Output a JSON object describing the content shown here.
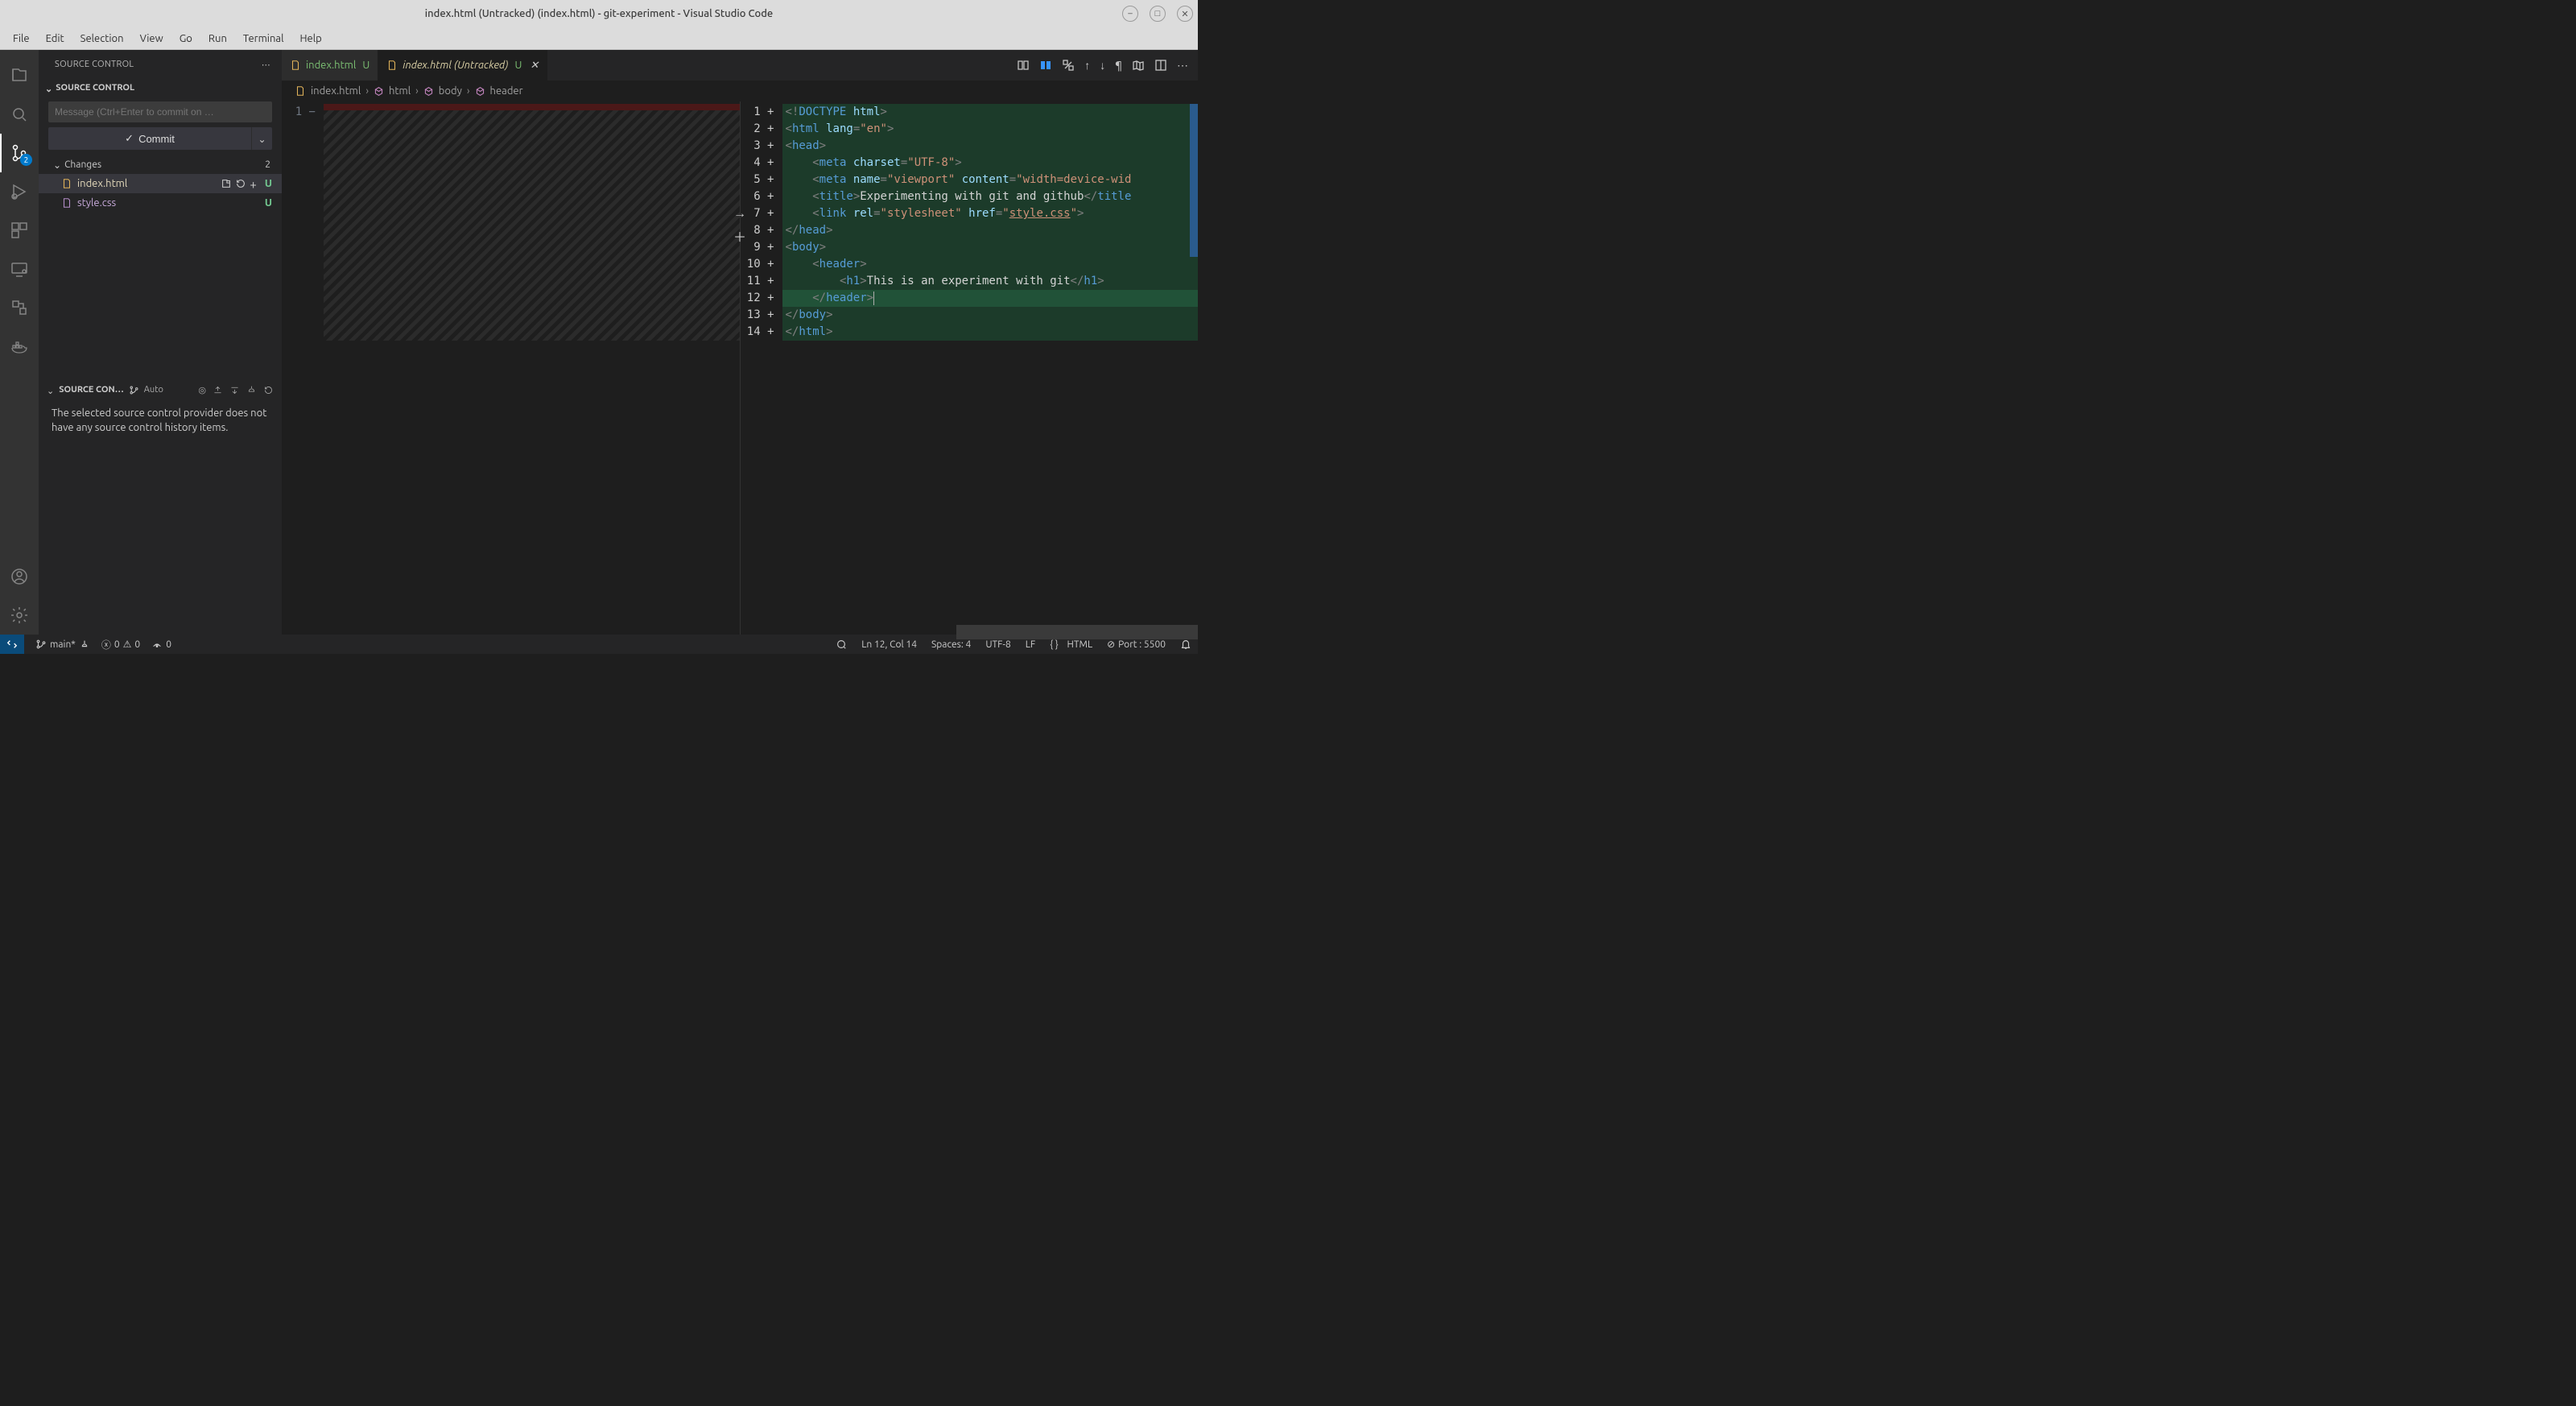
{
  "titlebar": {
    "title": "index.html (Untracked) (index.html) - git-experiment - Visual Studio Code"
  },
  "menubar": [
    "File",
    "Edit",
    "Selection",
    "View",
    "Go",
    "Run",
    "Terminal",
    "Help"
  ],
  "activitybar": {
    "scm_badge": "2"
  },
  "sidebar": {
    "title": "SOURCE CONTROL",
    "section1": "SOURCE CONTROL",
    "commit_placeholder": "Message (Ctrl+Enter to commit on …",
    "commit_label": "Commit",
    "changes_label": "Changes",
    "changes_count": "2",
    "files": [
      {
        "name": "index.html",
        "status": "U"
      },
      {
        "name": "style.css",
        "status": "U"
      }
    ],
    "graph_title": "SOURCE CON…",
    "graph_auto": "Auto",
    "graph_message": "The selected source control provider does not have any source control history items."
  },
  "tabs": {
    "tab1": {
      "label": "index.html",
      "status": "U"
    },
    "tab2": {
      "label": "index.html (Untracked)",
      "status": "U"
    }
  },
  "breadcrumb": {
    "file": "index.html",
    "p1": "html",
    "p2": "body",
    "p3": "header"
  },
  "code": {
    "lines": [
      {
        "n": "1",
        "tokens": [
          [
            "<!",
            "punc"
          ],
          [
            "DOCTYPE",
            "doc"
          ],
          [
            " ",
            "text"
          ],
          [
            "html",
            "attr"
          ],
          [
            ">",
            "punc"
          ]
        ]
      },
      {
        "n": "2",
        "tokens": [
          [
            "<",
            "punc"
          ],
          [
            "html",
            "tag"
          ],
          [
            " ",
            "text"
          ],
          [
            "lang",
            "attr"
          ],
          [
            "=",
            "punc"
          ],
          [
            "\"en\"",
            "str"
          ],
          [
            ">",
            "punc"
          ]
        ]
      },
      {
        "n": "3",
        "tokens": [
          [
            "<",
            "punc"
          ],
          [
            "head",
            "tag"
          ],
          [
            ">",
            "punc"
          ]
        ]
      },
      {
        "n": "4",
        "indent": 4,
        "tokens": [
          [
            "<",
            "punc"
          ],
          [
            "meta",
            "tag"
          ],
          [
            " ",
            "text"
          ],
          [
            "charset",
            "attr"
          ],
          [
            "=",
            "punc"
          ],
          [
            "\"UTF-8\"",
            "str"
          ],
          [
            ">",
            "punc"
          ]
        ]
      },
      {
        "n": "5",
        "indent": 4,
        "tokens": [
          [
            "<",
            "punc"
          ],
          [
            "meta",
            "tag"
          ],
          [
            " ",
            "text"
          ],
          [
            "name",
            "attr"
          ],
          [
            "=",
            "punc"
          ],
          [
            "\"viewport\"",
            "str"
          ],
          [
            " ",
            "text"
          ],
          [
            "content",
            "attr"
          ],
          [
            "=",
            "punc"
          ],
          [
            "\"width=device-wid",
            "str"
          ]
        ]
      },
      {
        "n": "6",
        "indent": 4,
        "tokens": [
          [
            "<",
            "punc"
          ],
          [
            "title",
            "tag"
          ],
          [
            ">",
            "punc"
          ],
          [
            "Experimenting with git and github",
            "text"
          ],
          [
            "</",
            "punc"
          ],
          [
            "title",
            "tag"
          ]
        ]
      },
      {
        "n": "7",
        "indent": 4,
        "tokens": [
          [
            "<",
            "punc"
          ],
          [
            "link",
            "tag"
          ],
          [
            " ",
            "text"
          ],
          [
            "rel",
            "attr"
          ],
          [
            "=",
            "punc"
          ],
          [
            "\"stylesheet\"",
            "str"
          ],
          [
            " ",
            "text"
          ],
          [
            "href",
            "attr"
          ],
          [
            "=",
            "punc"
          ],
          [
            "\"",
            "str"
          ],
          [
            "style.css",
            "link"
          ],
          [
            "\"",
            "str"
          ],
          [
            ">",
            "punc"
          ]
        ]
      },
      {
        "n": "8",
        "tokens": [
          [
            "</",
            "punc"
          ],
          [
            "head",
            "tag"
          ],
          [
            ">",
            "punc"
          ]
        ]
      },
      {
        "n": "9",
        "tokens": [
          [
            "<",
            "punc"
          ],
          [
            "body",
            "tag"
          ],
          [
            ">",
            "punc"
          ]
        ]
      },
      {
        "n": "10",
        "indent": 4,
        "tokens": [
          [
            "<",
            "punc"
          ],
          [
            "header",
            "tag"
          ],
          [
            ">",
            "punc"
          ]
        ]
      },
      {
        "n": "11",
        "indent": 8,
        "tokens": [
          [
            "<",
            "punc"
          ],
          [
            "h1",
            "tag"
          ],
          [
            ">",
            "punc"
          ],
          [
            "This is an experiment with git",
            "text"
          ],
          [
            "</",
            "punc"
          ],
          [
            "h1",
            "tag"
          ],
          [
            ">",
            "punc"
          ]
        ]
      },
      {
        "n": "12",
        "indent": 4,
        "caret": true,
        "tokens": [
          [
            "</",
            "punc"
          ],
          [
            "header",
            "tag"
          ],
          [
            ">",
            "punc"
          ]
        ]
      },
      {
        "n": "13",
        "tokens": [
          [
            "</",
            "punc"
          ],
          [
            "body",
            "tag"
          ],
          [
            ">",
            "punc"
          ]
        ]
      },
      {
        "n": "14",
        "tokens": [
          [
            "</",
            "punc"
          ],
          [
            "html",
            "tag"
          ],
          [
            ">",
            "punc"
          ]
        ]
      }
    ]
  },
  "statusbar": {
    "branch": "main*",
    "errors": "0",
    "warnings": "0",
    "radio": "0",
    "ln_col": "Ln 12, Col 14",
    "spaces": "Spaces: 4",
    "encoding": "UTF-8",
    "eol": "LF",
    "lang": "HTML",
    "port": "Port : 5500"
  }
}
